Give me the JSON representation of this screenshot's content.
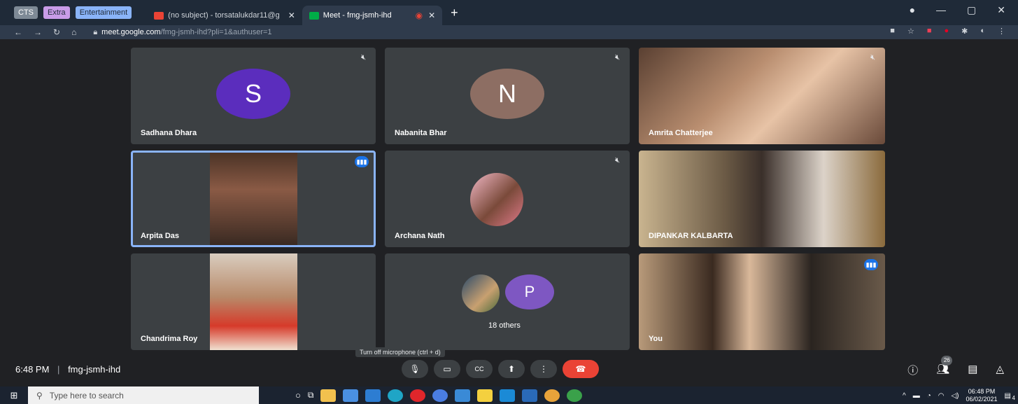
{
  "browser": {
    "groups": [
      {
        "label": "CTS",
        "bg": "#7e8a96",
        "fg": "#ffffff"
      },
      {
        "label": "Extra",
        "bg": "#c99ce8",
        "fg": "#1f2a38"
      },
      {
        "label": "Entertainment",
        "bg": "#8ab4f8",
        "fg": "#1f2a38"
      }
    ],
    "tabs": [
      {
        "title": "(no subject) - torsatalukdar11@g",
        "close": "✕"
      },
      {
        "title": "Meet - fmg-jsmh-ihd",
        "close": "✕"
      }
    ],
    "new_tab": "+",
    "url_host": "meet.google.com",
    "url_path": "/fmg-jsmh-ihd?pli=1&authuser=1"
  },
  "participants": [
    {
      "name": "Sadhana Dhara",
      "avatar_letter": "S",
      "avatar_color": "#5b2dbd"
    },
    {
      "name": "Nabanita Bhar",
      "avatar_letter": "N",
      "avatar_color": "#8d6e63"
    },
    {
      "name": "Amrita Chatterjee"
    },
    {
      "name": "Arpita Das"
    },
    {
      "name": "Archana Nath"
    },
    {
      "name": "DIPANKAR KALBARTA"
    },
    {
      "name": "Chandrima Roy"
    },
    {
      "others_label": "18 others",
      "avatar_letter": "P",
      "avatar_color": "#7e57c2"
    },
    {
      "name": "You"
    }
  ],
  "meeting": {
    "time": "6:48 PM",
    "code": "fmg-jsmh-ihd",
    "tooltip": "Turn off microphone (ctrl + d)",
    "participant_count": "26"
  },
  "taskbar": {
    "search_placeholder": "Type here to search",
    "clock_time": "06:48 PM",
    "clock_date": "06/02/2021",
    "notif_count": "4"
  }
}
